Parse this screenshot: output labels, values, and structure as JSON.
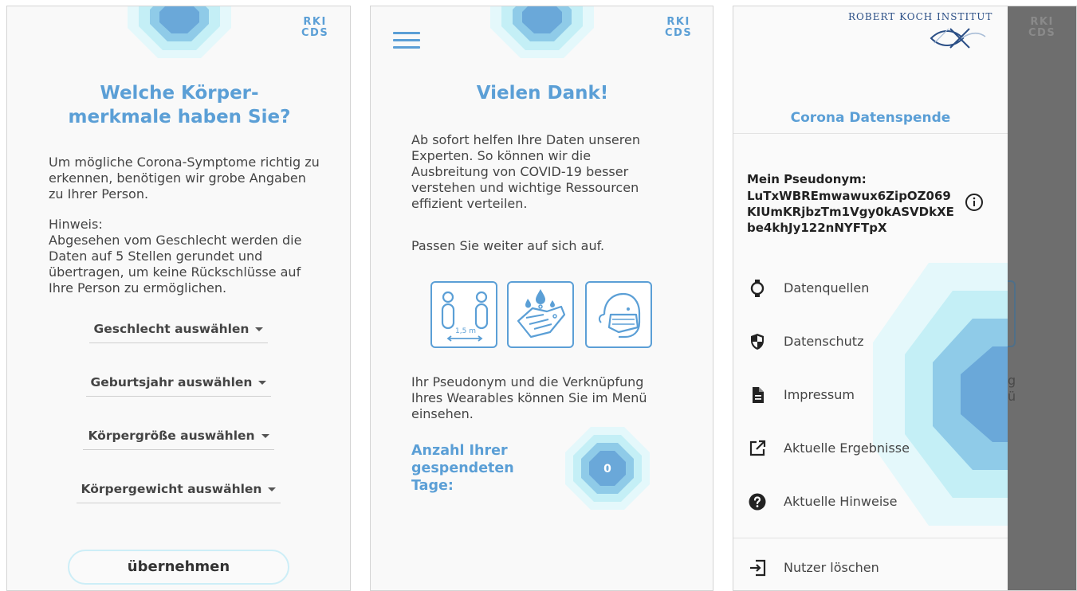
{
  "brand": {
    "rki_short": "RKI",
    "cds_short": "CDS",
    "institute": "ROBERT KOCH INSTITUT",
    "accent_color": "#5b9fd6"
  },
  "screen1": {
    "title_line1": "Welche Körper-",
    "title_line2": "merkmale haben Sie?",
    "intro": "Um mögliche Corona-Symptome richtig zu erkennen, benötigen wir grobe Angaben zu Ihrer Person.",
    "hint_label": "Hinweis:",
    "hint_text": "Abgesehen vom Geschlecht werden die Daten auf 5 Stellen gerundet und übertragen, um keine Rückschlüsse auf Ihre Person zu ermöglichen.",
    "dropdowns": [
      {
        "label": "Geschlecht auswählen"
      },
      {
        "label": "Geburtsjahr auswählen"
      },
      {
        "label": "Körpergröße auswählen"
      },
      {
        "label": "Körpergewicht auswählen"
      }
    ],
    "submit_label": "übernehmen"
  },
  "screen2": {
    "title": "Vielen Dank!",
    "p1": "Ab sofort helfen Ihre Daten unseren Experten. So können wir die Ausbreitung von COVID-19 besser verstehen und wichtige Ressourcen effizient verteilen.",
    "p2": "Passen Sie weiter auf sich auf.",
    "distance_label": "1,5 m",
    "p3": "Ihr Pseudonym und die Verknüpfung Ihres Wearables können Sie im Menü einsehen.",
    "days_label_1": "Anzahl Ihrer",
    "days_label_2": "gespendeten",
    "days_label_3": "Tage:",
    "days_count": "0"
  },
  "screen3": {
    "drawer_title": "Corona Datenspende",
    "pseudonym_label": "Mein Pseudonym:",
    "pseudonym_value": "LuTxWBREmwawux6ZipOZ069KIUmKRjbzTm1Vgy0kASVDkXEbe4khJy122nNYFTpX",
    "menu": [
      {
        "label": "Datenquellen",
        "icon": "watch-icon"
      },
      {
        "label": "Datenschutz",
        "icon": "shield-icon"
      },
      {
        "label": "Impressum",
        "icon": "document-icon"
      },
      {
        "label": "Aktuelle Ergebnisse",
        "icon": "external-link-icon"
      },
      {
        "label": "Aktuelle Hinweise",
        "icon": "help-icon"
      }
    ],
    "delete_user_label": "Nutzer löschen",
    "behind_fragment_1": "g",
    "behind_fragment_2": "ü"
  }
}
